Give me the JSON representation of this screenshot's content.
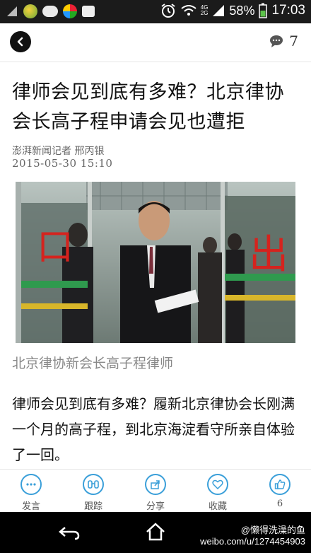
{
  "status_bar": {
    "battery_pct": "58%",
    "time": "17:03",
    "net_top": "4G",
    "net_bottom": "2G"
  },
  "header": {
    "comment_count": "7"
  },
  "article": {
    "title": "律师会见到底有多难？北京律协会长高子程申请会见也遭拒",
    "byline": "澎湃新闻记者 邢丙银",
    "date": "2015-05-30 15:10",
    "photo_caption": "北京律协新会长高子程律师",
    "photo_sign_left": "口",
    "photo_sign_right": "出",
    "body": "律师会见到底有多难？履新北京律协会长刚满一个月的高子程，到北京海淀看守所亲自体验了一回。"
  },
  "toolbar": {
    "items": [
      {
        "label": "发言",
        "icon": "comment-icon"
      },
      {
        "label": "跟踪",
        "icon": "binoculars-icon"
      },
      {
        "label": "分享",
        "icon": "share-icon"
      },
      {
        "label": "收藏",
        "icon": "heart-icon"
      },
      {
        "label": "6",
        "icon": "thumbs-up-icon"
      }
    ]
  },
  "watermark": {
    "line1": "@懒得洗澡的鱼",
    "line2": "weibo.com/u/1274454903"
  },
  "colors": {
    "accent": "#3a9fd9",
    "status_bar": "#1b1b1b",
    "nav_bar": "#000000"
  }
}
